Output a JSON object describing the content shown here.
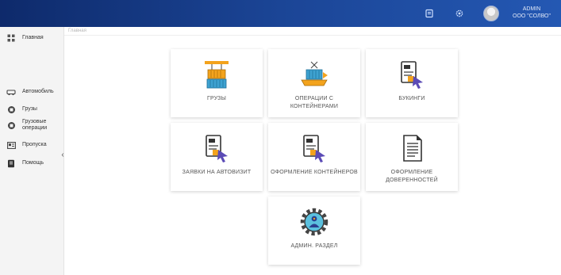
{
  "header": {
    "user_role": "ADMIN",
    "user_org": "ООО \"СОЛВО\""
  },
  "sidebar": {
    "items": [
      {
        "label": "Главная",
        "icon": "grid-icon"
      },
      {
        "label": "Автомобиль",
        "icon": "car-icon"
      },
      {
        "label": "Грузы",
        "icon": "cargo-icon"
      },
      {
        "label": "Грузовые операции",
        "icon": "cargo-operations-icon"
      },
      {
        "label": "Пропуска",
        "icon": "pass-icon"
      },
      {
        "label": "Помощь",
        "icon": "help-book-icon"
      }
    ],
    "collapse_glyph": "‹"
  },
  "breadcrumb": "Главная",
  "tiles": [
    {
      "label": "ГРУЗЫ",
      "icon": "container-crane-icon"
    },
    {
      "label": "ОПЕРАЦИИ С КОНТЕЙНЕРАМИ",
      "icon": "container-ship-icon"
    },
    {
      "label": "БУКИНГИ",
      "icon": "document-cursor-icon"
    },
    {
      "label": "ЗАЯВКИ НА АВТОВИЗИТ",
      "icon": "document-cursor-icon"
    },
    {
      "label": "ОФОРМЛЕНИЕ КОНТЕЙНЕРОВ",
      "icon": "document-cursor-icon"
    },
    {
      "label": "ОФОРМЛЕНИЕ ДОВЕРЕННОСТЕЙ",
      "icon": "document-lines-icon"
    },
    {
      "label": "АДМИН. РАЗДЕЛ",
      "icon": "gear-admin-icon"
    }
  ]
}
